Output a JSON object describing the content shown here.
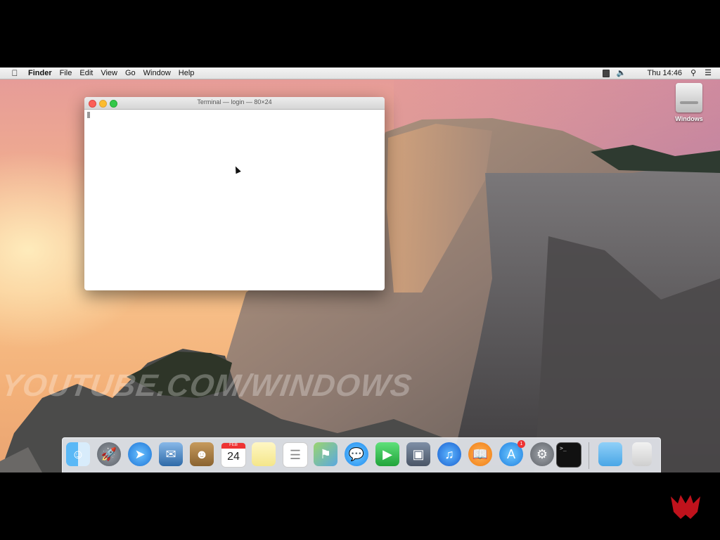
{
  "menubar": {
    "apple_icon": "apple-icon",
    "app_name": "Finder",
    "items": [
      "File",
      "Edit",
      "View",
      "Go",
      "Window",
      "Help"
    ],
    "clock": "Thu 14:46",
    "status_icons": [
      "battery-icon",
      "volume-icon",
      "spotlight-search-icon",
      "notification-center-icon"
    ]
  },
  "desktop": {
    "drive_label": "Windows",
    "watermark": "YOUTUBE.COM/WINDOWS"
  },
  "terminal": {
    "title": "Terminal — login — 80×24"
  },
  "dock": {
    "calendar_month": "FEB",
    "calendar_day": "24",
    "app_store_badge": "1",
    "terminal_prompt": ">_",
    "items": [
      "Finder",
      "Launchpad",
      "Safari",
      "Mail",
      "Contacts",
      "Calendar",
      "Notes",
      "Reminders",
      "Maps",
      "Messages",
      "FaceTime",
      "Photo Booth",
      "iTunes",
      "iBooks",
      "App Store",
      "System Preferences",
      "Terminal",
      "Downloads",
      "Trash"
    ]
  },
  "colors": {
    "close": "#fc5f57",
    "minimize": "#fdbc2e",
    "maximize": "#34c84a"
  }
}
